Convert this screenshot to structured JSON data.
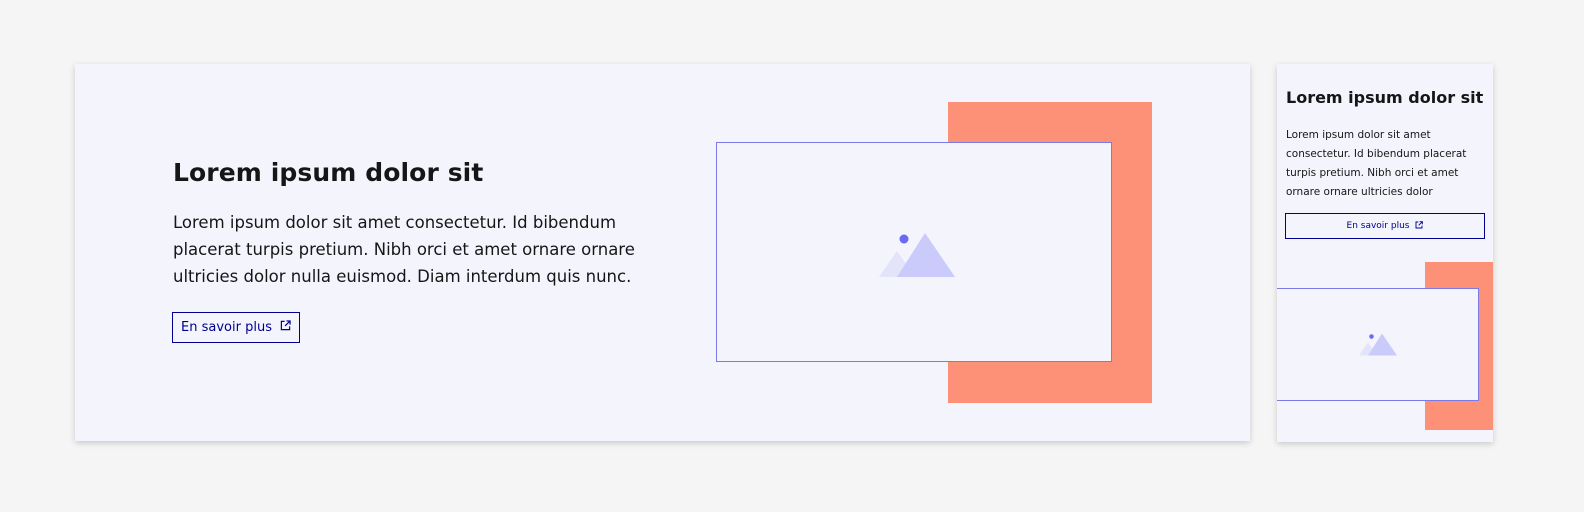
{
  "colors": {
    "page_background": "#f5f5f5",
    "card_background": "#f4f4fd",
    "title_text": "#161616",
    "button_blue": "#000091",
    "accent_orange": "#fc9178",
    "frame_border": "#7b7be8"
  },
  "desktop_card": {
    "title": "Lorem ipsum dolor sit",
    "description": "Lorem ipsum dolor sit amet consectetur. Id bibendum placerat turpis pretium. Nibh orci et amet ornare ornare ultricies dolor nulla euismod. Diam interdum quis nunc.",
    "button_label": "En savoir plus",
    "button_icon": "external-link-icon",
    "image_icon": "image-placeholder-icon"
  },
  "mobile_card": {
    "title": "Lorem ipsum dolor sit",
    "description": "Lorem ipsum dolor sit amet consectetur. Id bibendum placerat turpis pretium. Nibh orci et amet ornare ornare ultricies dolor",
    "button_label": "En savoir plus",
    "button_icon": "external-link-icon",
    "image_icon": "image-placeholder-icon"
  }
}
